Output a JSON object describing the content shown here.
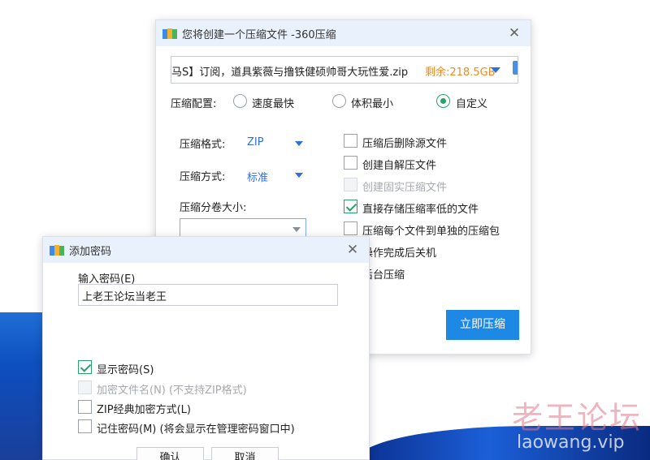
{
  "main_window": {
    "title": "您将创建一个压缩文件 -360压缩",
    "close_icon": "close-icon",
    "path_text": "马S】订阅，道具紫薇与撸铁健硕帅哥大玩性爱.zip",
    "free_space": "剩余:218.5GB",
    "config_label": "压缩配置:",
    "presets": [
      {
        "label": "速度最快",
        "selected": false
      },
      {
        "label": "体积最小",
        "selected": false
      },
      {
        "label": "自定义",
        "selected": true
      }
    ],
    "format_label": "压缩格式:",
    "format_value": "ZIP",
    "method_label": "压缩方式:",
    "method_value": "标准",
    "volume_label": "压缩分卷大小:",
    "volume_value": "",
    "options": [
      {
        "label": "压缩后删除源文件",
        "checked": false,
        "disabled": false
      },
      {
        "label": "创建自解压文件",
        "checked": false,
        "disabled": false
      },
      {
        "label": "创建固实压缩文件",
        "checked": false,
        "disabled": true
      },
      {
        "label": "直接存储压缩率低的文件",
        "checked": true,
        "disabled": false
      },
      {
        "label": "压缩每个文件到单独的压缩包",
        "checked": false,
        "disabled": false
      },
      {
        "label": "操作完成后关机",
        "checked": false,
        "disabled": false
      },
      {
        "label": "后台压缩",
        "checked": false,
        "disabled": false
      }
    ],
    "compress_button": "立即压缩"
  },
  "password_dialog": {
    "title": "添加密码",
    "input_label": "输入密码(E)",
    "password_value": "上老王论坛当老王",
    "options": [
      {
        "label": "显示密码(S)",
        "checked": true,
        "disabled": false
      },
      {
        "label": "加密文件名(N) (不支持ZIP格式)",
        "checked": false,
        "disabled": true
      },
      {
        "label": "ZIP经典加密方式(L)",
        "checked": false,
        "disabled": false
      },
      {
        "label": "记住密码(M) (将会显示在管理密码窗口中)",
        "checked": false,
        "disabled": false
      }
    ],
    "ok_button": "确认",
    "cancel_button": "取消"
  },
  "watermark": {
    "cn": "老王论坛",
    "en": "laowang.vip"
  },
  "colors": {
    "accent": "#1e88e5",
    "check_green": "#27a36a",
    "free_space_orange": "#f08a24",
    "titlebar": "#e9f1fc"
  }
}
